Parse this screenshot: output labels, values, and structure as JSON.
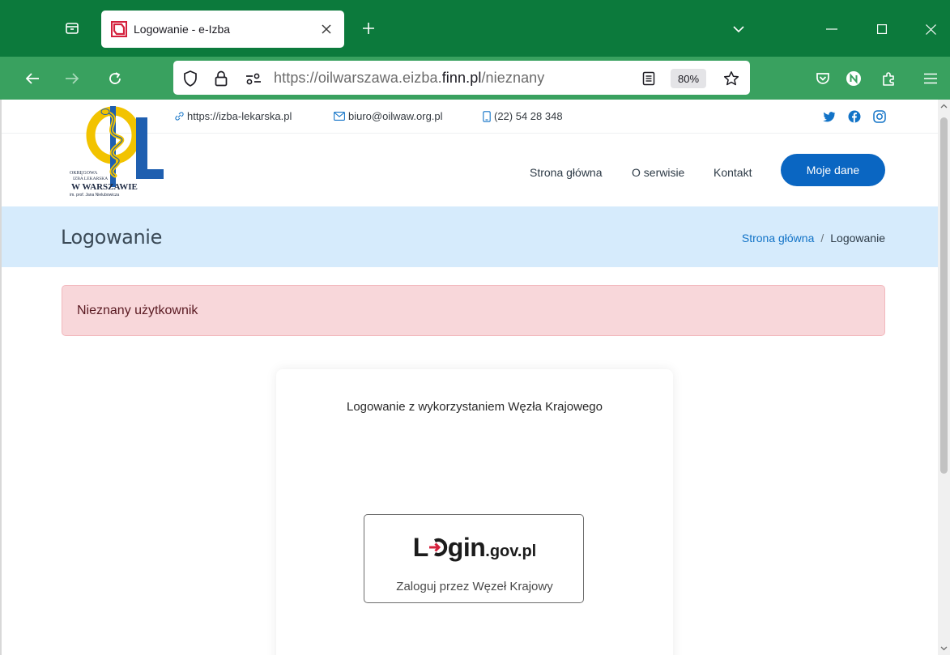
{
  "browser": {
    "tab_title": "Logowanie - e-Izba",
    "url_host_pre": "https://oilwarszawa.eizba.",
    "url_host_bold": "finn.pl",
    "url_path": "/nieznany",
    "zoom": "80%"
  },
  "topbar": {
    "website": "https://izba-lekarska.pl",
    "email": "biuro@oilwaw.org.pl",
    "phone": "(22) 54 28 348"
  },
  "logo": {
    "line1": "OKRĘGOWA",
    "line2": "IZBA LEKARSKA",
    "line3": "W WARSZAWIE",
    "line4": "im. prof. Jana Nielubowicza"
  },
  "nav": {
    "items": [
      "Strona główna",
      "O serwisie",
      "Kontakt"
    ],
    "cta": "Moje dane"
  },
  "hero": {
    "title": "Logowanie",
    "breadcrumb_home": "Strona główna",
    "breadcrumb_sep": "/",
    "breadcrumb_current": "Logowanie"
  },
  "alert": {
    "message": "Nieznany użytkownik"
  },
  "login_card": {
    "title": "Logowanie z wykorzystaniem Węzła Krajowego",
    "brand_l": "L",
    "brand_gin": "gin",
    "brand_domain": ".gov.pl",
    "button_label": "Zaloguj przez Węzeł Krajowy"
  },
  "colors": {
    "tabbar": "#0c7a3c",
    "navbar": "#39a15f",
    "primary": "#0a66c2",
    "hero_bg": "#d6ebfc",
    "alert_bg": "#f8d7da",
    "login_accent": "#d4213d"
  }
}
